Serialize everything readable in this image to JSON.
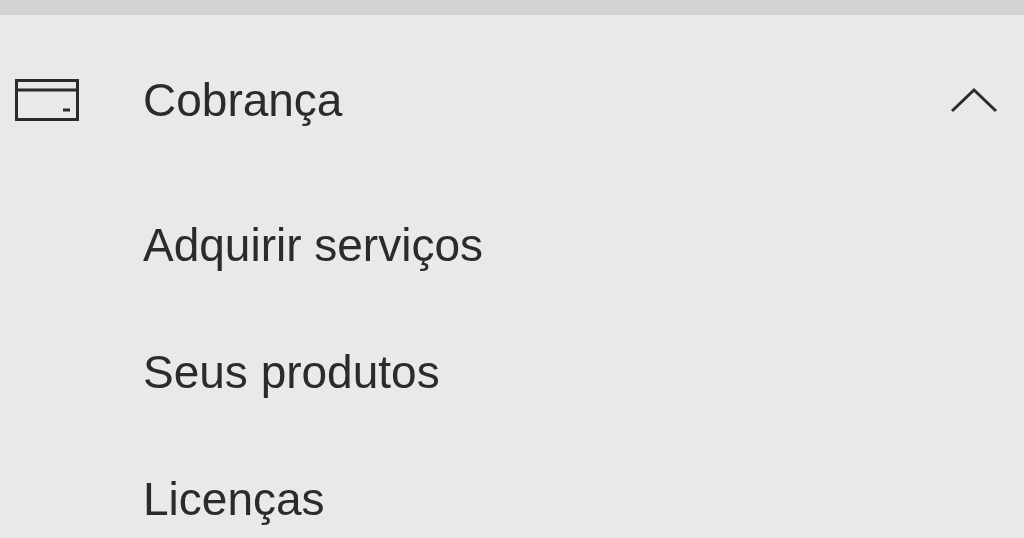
{
  "section": {
    "label": "Cobrança",
    "expanded": true,
    "items": [
      {
        "label": "Adquirir serviços"
      },
      {
        "label": "Seus produtos"
      },
      {
        "label": "Licenças"
      }
    ]
  }
}
